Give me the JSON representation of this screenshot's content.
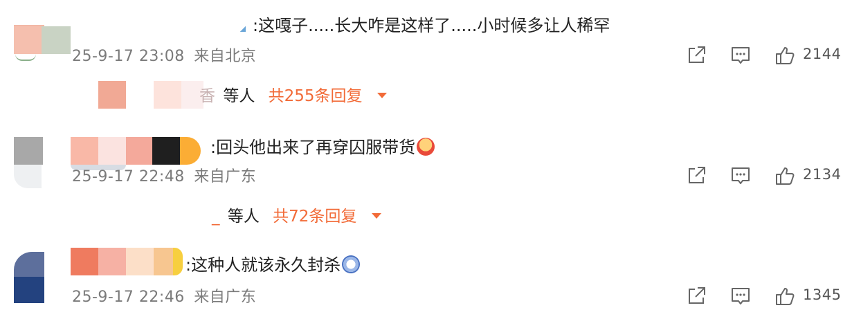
{
  "comments": [
    {
      "text": ":这嘎子.....长大咋是这样了.....小时候多让人稀罕",
      "time": "25-9-17 23:08",
      "location": "来自北京",
      "likes": "2144",
      "reply_people": "等人",
      "reply_count": "共255条回复",
      "reply_name_tail": "香"
    },
    {
      "text": ":回头他出来了再穿囚服带货",
      "time": "25-9-17 22:48",
      "location": "来自广东",
      "likes": "2134",
      "reply_people": "等人",
      "reply_count": "共72条回复",
      "reply_name_tail": "_"
    },
    {
      "text": ":这种人就该永久封杀",
      "time": "25-9-17 22:46",
      "location": "来自广东",
      "likes": "1345"
    }
  ],
  "icons": {
    "share": "share-icon",
    "comment": "comment-icon",
    "like": "thumbs-up-icon"
  },
  "colors": {
    "reply_accent": "#f26b38",
    "meta_text": "#7a7a7a"
  }
}
